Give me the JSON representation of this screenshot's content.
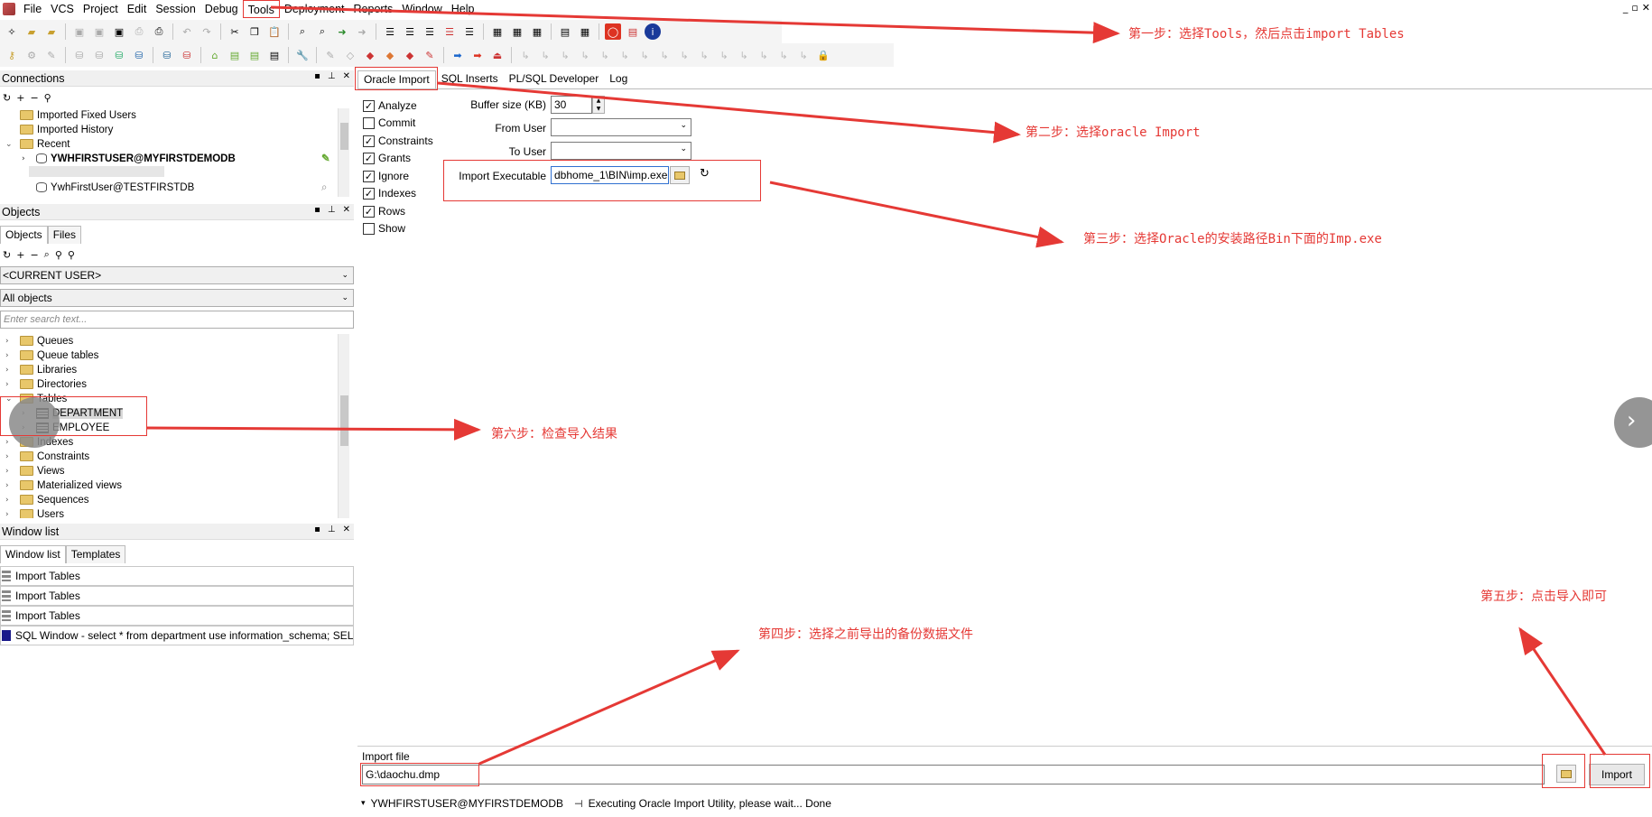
{
  "menu": {
    "items": [
      "File",
      "VCS",
      "Project",
      "Edit",
      "Session",
      "Debug",
      "Tools",
      "Deployment",
      "Reports",
      "Window",
      "Help"
    ]
  },
  "connections": {
    "title": "Connections",
    "items": [
      "Imported Fixed Users",
      "Imported History",
      "Recent",
      "YWHFIRSTUSER@MYFIRSTDEMODB",
      "YwhFirstUser@TESTFIRSTDB"
    ]
  },
  "objects": {
    "title": "Objects",
    "tabs": [
      "Objects",
      "Files"
    ],
    "user_select": "<CURRENT USER>",
    "filter_select": "All objects",
    "search_placeholder": "Enter search text...",
    "tree": [
      "Queues",
      "Queue tables",
      "Libraries",
      "Directories",
      "Tables",
      "DEPARTMENT",
      "EMPLOYEE",
      "Indexes",
      "Constraints",
      "Views",
      "Materialized views",
      "Sequences",
      "Users"
    ]
  },
  "window_list": {
    "title": "Window list",
    "tabs": [
      "Window list",
      "Templates"
    ],
    "items": [
      "Import Tables",
      "Import Tables",
      "Import Tables",
      "SQL Window - select * from department use information_schema; SELEC"
    ]
  },
  "main_tabs": [
    "Oracle Import",
    "SQL Inserts",
    "PL/SQL Developer",
    "Log"
  ],
  "options": {
    "analyze": {
      "label": "Analyze",
      "checked": true
    },
    "commit": {
      "label": "Commit",
      "checked": false
    },
    "constraints": {
      "label": "Constraints",
      "checked": true
    },
    "grants": {
      "label": "Grants",
      "checked": true
    },
    "ignore": {
      "label": "Ignore",
      "checked": true
    },
    "indexes": {
      "label": "Indexes",
      "checked": true
    },
    "rows": {
      "label": "Rows",
      "checked": true
    },
    "show": {
      "label": "Show",
      "checked": false
    }
  },
  "form": {
    "buffer_label": "Buffer size (KB)",
    "buffer_value": "30",
    "from_user_label": "From User",
    "from_user_value": "",
    "to_user_label": "To User",
    "to_user_value": "",
    "exec_label": "Import Executable",
    "exec_value": "dbhome_1\\BIN\\imp.exe"
  },
  "import": {
    "file_label": "Import file",
    "file_value": "G:\\daochu.dmp",
    "button_label": "Import"
  },
  "status": {
    "connection": "YWHFIRSTUSER@MYFIRSTDEMODB",
    "message": "Executing Oracle Import Utility, please wait... Done"
  },
  "annotations": {
    "step1": "第一步：选择Tools，然后点击import Tables",
    "step2": "第二步：选择oracle Import",
    "step3": "第三步：选择Oracle的安装路径Bin下面的Imp.exe",
    "step4": "第四步：选择之前导出的备份数据文件",
    "step5": "第五步：点击导入即可",
    "step6": "第六步：检查导入结果"
  },
  "colors": {
    "annotation": "#e53935",
    "folder": "#e8c76a"
  }
}
